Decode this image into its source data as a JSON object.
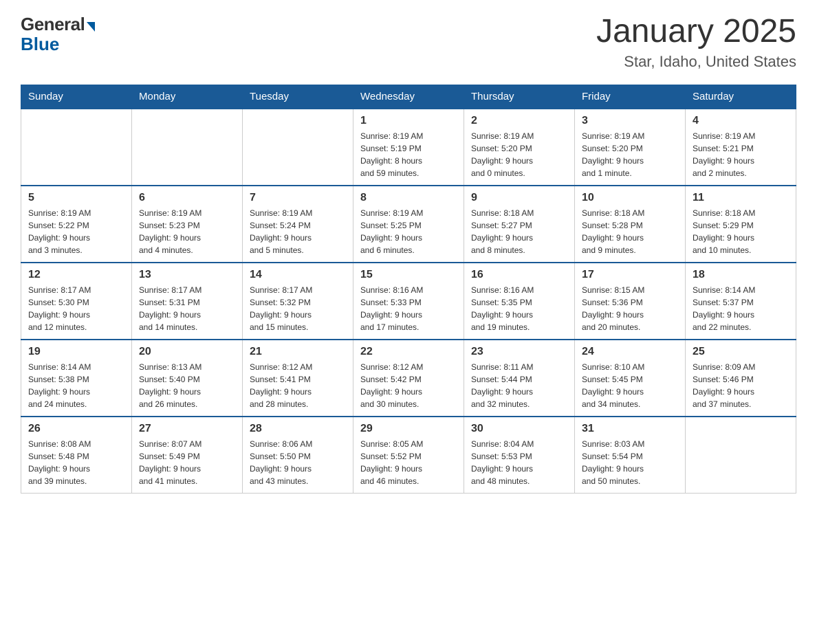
{
  "logo": {
    "general": "General",
    "blue": "Blue"
  },
  "header": {
    "title": "January 2025",
    "subtitle": "Star, Idaho, United States"
  },
  "weekdays": [
    "Sunday",
    "Monday",
    "Tuesday",
    "Wednesday",
    "Thursday",
    "Friday",
    "Saturday"
  ],
  "weeks": [
    [
      {
        "day": "",
        "info": ""
      },
      {
        "day": "",
        "info": ""
      },
      {
        "day": "",
        "info": ""
      },
      {
        "day": "1",
        "info": "Sunrise: 8:19 AM\nSunset: 5:19 PM\nDaylight: 8 hours\nand 59 minutes."
      },
      {
        "day": "2",
        "info": "Sunrise: 8:19 AM\nSunset: 5:20 PM\nDaylight: 9 hours\nand 0 minutes."
      },
      {
        "day": "3",
        "info": "Sunrise: 8:19 AM\nSunset: 5:20 PM\nDaylight: 9 hours\nand 1 minute."
      },
      {
        "day": "4",
        "info": "Sunrise: 8:19 AM\nSunset: 5:21 PM\nDaylight: 9 hours\nand 2 minutes."
      }
    ],
    [
      {
        "day": "5",
        "info": "Sunrise: 8:19 AM\nSunset: 5:22 PM\nDaylight: 9 hours\nand 3 minutes."
      },
      {
        "day": "6",
        "info": "Sunrise: 8:19 AM\nSunset: 5:23 PM\nDaylight: 9 hours\nand 4 minutes."
      },
      {
        "day": "7",
        "info": "Sunrise: 8:19 AM\nSunset: 5:24 PM\nDaylight: 9 hours\nand 5 minutes."
      },
      {
        "day": "8",
        "info": "Sunrise: 8:19 AM\nSunset: 5:25 PM\nDaylight: 9 hours\nand 6 minutes."
      },
      {
        "day": "9",
        "info": "Sunrise: 8:18 AM\nSunset: 5:27 PM\nDaylight: 9 hours\nand 8 minutes."
      },
      {
        "day": "10",
        "info": "Sunrise: 8:18 AM\nSunset: 5:28 PM\nDaylight: 9 hours\nand 9 minutes."
      },
      {
        "day": "11",
        "info": "Sunrise: 8:18 AM\nSunset: 5:29 PM\nDaylight: 9 hours\nand 10 minutes."
      }
    ],
    [
      {
        "day": "12",
        "info": "Sunrise: 8:17 AM\nSunset: 5:30 PM\nDaylight: 9 hours\nand 12 minutes."
      },
      {
        "day": "13",
        "info": "Sunrise: 8:17 AM\nSunset: 5:31 PM\nDaylight: 9 hours\nand 14 minutes."
      },
      {
        "day": "14",
        "info": "Sunrise: 8:17 AM\nSunset: 5:32 PM\nDaylight: 9 hours\nand 15 minutes."
      },
      {
        "day": "15",
        "info": "Sunrise: 8:16 AM\nSunset: 5:33 PM\nDaylight: 9 hours\nand 17 minutes."
      },
      {
        "day": "16",
        "info": "Sunrise: 8:16 AM\nSunset: 5:35 PM\nDaylight: 9 hours\nand 19 minutes."
      },
      {
        "day": "17",
        "info": "Sunrise: 8:15 AM\nSunset: 5:36 PM\nDaylight: 9 hours\nand 20 minutes."
      },
      {
        "day": "18",
        "info": "Sunrise: 8:14 AM\nSunset: 5:37 PM\nDaylight: 9 hours\nand 22 minutes."
      }
    ],
    [
      {
        "day": "19",
        "info": "Sunrise: 8:14 AM\nSunset: 5:38 PM\nDaylight: 9 hours\nand 24 minutes."
      },
      {
        "day": "20",
        "info": "Sunrise: 8:13 AM\nSunset: 5:40 PM\nDaylight: 9 hours\nand 26 minutes."
      },
      {
        "day": "21",
        "info": "Sunrise: 8:12 AM\nSunset: 5:41 PM\nDaylight: 9 hours\nand 28 minutes."
      },
      {
        "day": "22",
        "info": "Sunrise: 8:12 AM\nSunset: 5:42 PM\nDaylight: 9 hours\nand 30 minutes."
      },
      {
        "day": "23",
        "info": "Sunrise: 8:11 AM\nSunset: 5:44 PM\nDaylight: 9 hours\nand 32 minutes."
      },
      {
        "day": "24",
        "info": "Sunrise: 8:10 AM\nSunset: 5:45 PM\nDaylight: 9 hours\nand 34 minutes."
      },
      {
        "day": "25",
        "info": "Sunrise: 8:09 AM\nSunset: 5:46 PM\nDaylight: 9 hours\nand 37 minutes."
      }
    ],
    [
      {
        "day": "26",
        "info": "Sunrise: 8:08 AM\nSunset: 5:48 PM\nDaylight: 9 hours\nand 39 minutes."
      },
      {
        "day": "27",
        "info": "Sunrise: 8:07 AM\nSunset: 5:49 PM\nDaylight: 9 hours\nand 41 minutes."
      },
      {
        "day": "28",
        "info": "Sunrise: 8:06 AM\nSunset: 5:50 PM\nDaylight: 9 hours\nand 43 minutes."
      },
      {
        "day": "29",
        "info": "Sunrise: 8:05 AM\nSunset: 5:52 PM\nDaylight: 9 hours\nand 46 minutes."
      },
      {
        "day": "30",
        "info": "Sunrise: 8:04 AM\nSunset: 5:53 PM\nDaylight: 9 hours\nand 48 minutes."
      },
      {
        "day": "31",
        "info": "Sunrise: 8:03 AM\nSunset: 5:54 PM\nDaylight: 9 hours\nand 50 minutes."
      },
      {
        "day": "",
        "info": ""
      }
    ]
  ]
}
